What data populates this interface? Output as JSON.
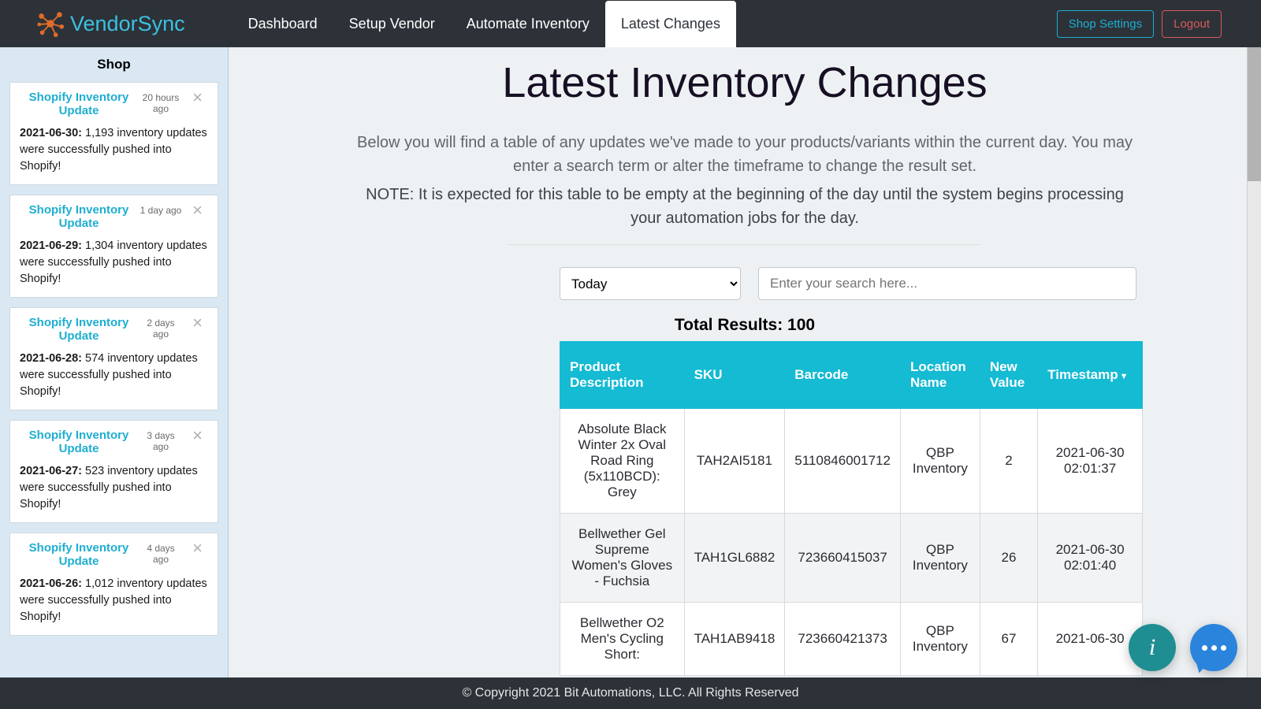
{
  "brand": {
    "name": "VendorSync"
  },
  "nav": {
    "items": [
      "Dashboard",
      "Setup Vendor",
      "Automate Inventory",
      "Latest Changes"
    ],
    "active": 3,
    "shop_settings": "Shop Settings",
    "logout": "Logout"
  },
  "sidebar": {
    "title": "Shop",
    "notifications": [
      {
        "title": "Shopify Inventory Update",
        "time": "20 hours ago",
        "date": "2021-06-30:",
        "msg": " 1,193 inventory updates were successfully pushed into Shopify!"
      },
      {
        "title": "Shopify Inventory Update",
        "time": "1 day ago",
        "date": "2021-06-29:",
        "msg": " 1,304 inventory updates were successfully pushed into Shopify!"
      },
      {
        "title": "Shopify Inventory Update",
        "time": "2 days ago",
        "date": "2021-06-28:",
        "msg": " 574 inventory updates were successfully pushed into Shopify!"
      },
      {
        "title": "Shopify Inventory Update",
        "time": "3 days ago",
        "date": "2021-06-27:",
        "msg": " 523 inventory updates were successfully pushed into Shopify!"
      },
      {
        "title": "Shopify Inventory Update",
        "time": "4 days ago",
        "date": "2021-06-26:",
        "msg": " 1,012 inventory updates were successfully pushed into Shopify!"
      }
    ]
  },
  "page": {
    "title": "Latest Inventory Changes",
    "lead": "Below you will find a table of any updates we've made to your products/variants within the current day. You may enter a search term or alter the timeframe to change the result set.",
    "note": "NOTE: It is expected for this table to be empty at the beginning of the day until the system begins processing your automation jobs for the day."
  },
  "controls": {
    "period_options": [
      "Today"
    ],
    "period_selected": "Today",
    "search_placeholder": "Enter your search here..."
  },
  "results": {
    "total_label": "Total Results: ",
    "total": "100",
    "columns": [
      "Product Description",
      "SKU",
      "Barcode",
      "Location Name",
      "New Value",
      "Timestamp"
    ],
    "sort_col": 5,
    "rows": [
      {
        "desc": "Absolute Black Winter 2x Oval Road Ring (5x110BCD): Grey",
        "sku": "TAH2AI5181",
        "barcode": "5110846001712",
        "location": "QBP Inventory",
        "new_value": "2",
        "ts": "2021-06-30 02:01:37"
      },
      {
        "desc": "Bellwether Gel Supreme Women's Gloves - Fuchsia",
        "sku": "TAH1GL6882",
        "barcode": "723660415037",
        "location": "QBP Inventory",
        "new_value": "26",
        "ts": "2021-06-30 02:01:40"
      },
      {
        "desc": "Bellwether O2 Men's Cycling Short:",
        "sku": "TAH1AB9418",
        "barcode": "723660421373",
        "location": "QBP Inventory",
        "new_value": "67",
        "ts": "2021-06-30"
      }
    ]
  },
  "footer": {
    "text": "© Copyright 2021 Bit Automations, LLC. All Rights Reserved"
  },
  "fab": {
    "info": "i"
  },
  "colors": {
    "accent": "#15bad3",
    "brand": "#3cc0e0",
    "nav_bg": "#2c3238"
  }
}
